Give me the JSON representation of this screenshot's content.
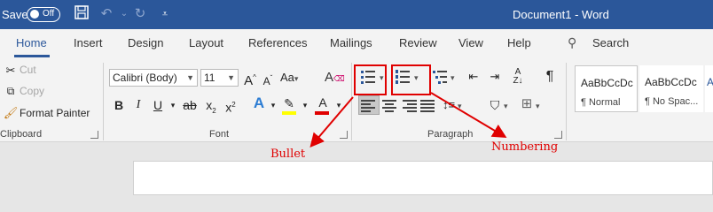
{
  "titlebar": {
    "autosave_label": "Save",
    "toggle_state": "Off",
    "doc_title": "Document1  -  Word",
    "save_icon": "save-icon",
    "undo_icon": "undo-icon",
    "redo_icon": "redo-icon",
    "customize_icon": "customize-qat-icon"
  },
  "tabs": [
    {
      "label": "Home"
    },
    {
      "label": "Insert"
    },
    {
      "label": "Design"
    },
    {
      "label": "Layout"
    },
    {
      "label": "References"
    },
    {
      "label": "Mailings"
    },
    {
      "label": "Review"
    },
    {
      "label": "View"
    },
    {
      "label": "Help"
    }
  ],
  "search_label": "Search",
  "clipboard": {
    "cut": "Cut",
    "copy": "Copy",
    "format_painter": "Format Painter",
    "group_label": "Clipboard"
  },
  "font": {
    "font_name": "Calibri (Body)",
    "font_size": "11",
    "grow": "A",
    "shrink": "A",
    "change_case": "Aa",
    "bold": "B",
    "italic": "I",
    "underline": "U",
    "strike": "ab",
    "subscript": "x",
    "superscript": "x",
    "text_effects": "A",
    "font_color": "A",
    "group_label": "Font"
  },
  "paragraph": {
    "group_label": "Paragraph",
    "show_marks": "¶"
  },
  "styles": [
    {
      "preview": "AaBbCcDc",
      "name": "¶ Normal"
    },
    {
      "preview": "AaBbCcDc",
      "name": "¶ No Spac..."
    },
    {
      "preview": "A",
      "name": ""
    }
  ],
  "annotations": {
    "bullet": "Bullet",
    "numbering": "Numbering"
  },
  "colors": {
    "brand": "#2b579a",
    "annotation_red": "#e00000"
  }
}
